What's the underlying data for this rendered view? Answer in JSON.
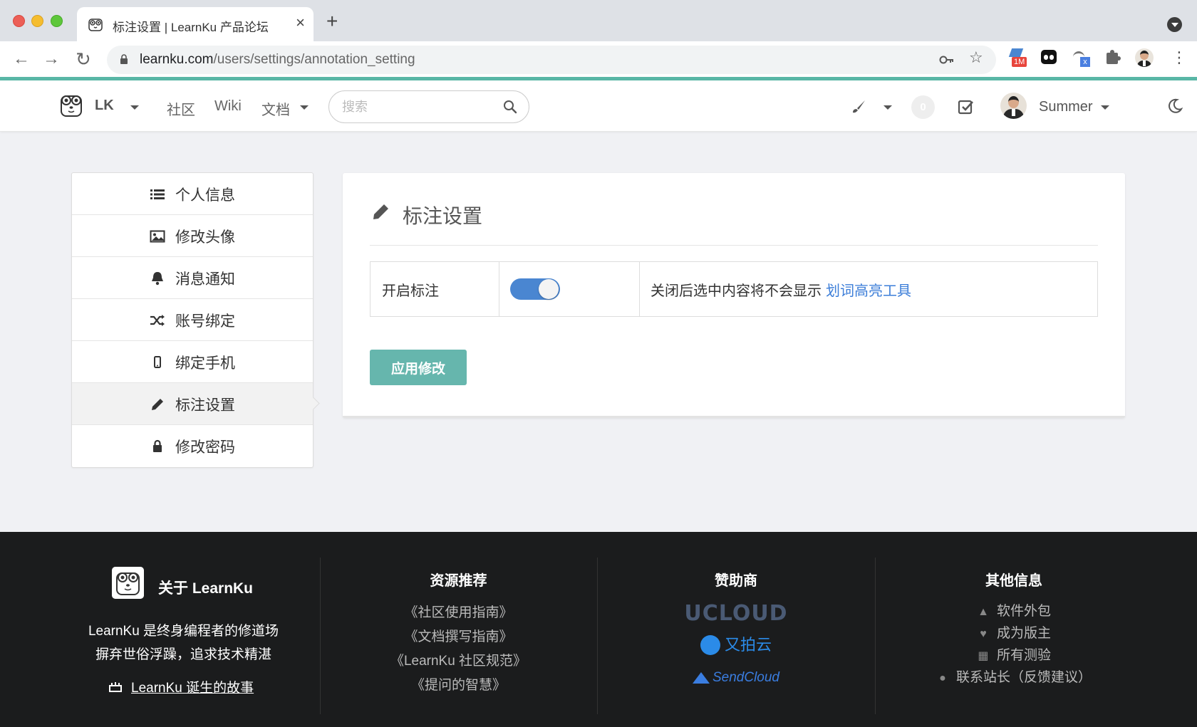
{
  "browser": {
    "tab_title": "标注设置 | LearnKu 产品论坛",
    "tab_close": "×",
    "new_tab": "+",
    "url_domain": "learnku.com",
    "url_path": "/users/settings/annotation_setting",
    "extension_badge": "1M"
  },
  "header": {
    "brand": "LK",
    "nav": [
      "社区",
      "Wiki",
      "文档"
    ],
    "search_placeholder": "搜索",
    "notification_count": "0",
    "user_name": "Summer"
  },
  "sidebar": {
    "items": [
      {
        "label": "个人信息",
        "icon": "list-icon"
      },
      {
        "label": "修改头像",
        "icon": "image-icon"
      },
      {
        "label": "消息通知",
        "icon": "bell-icon"
      },
      {
        "label": "账号绑定",
        "icon": "shuffle-icon"
      },
      {
        "label": "绑定手机",
        "icon": "mobile-icon"
      },
      {
        "label": "标注设置",
        "icon": "pencil-icon",
        "active": true
      },
      {
        "label": "修改密码",
        "icon": "lock-icon"
      }
    ]
  },
  "main": {
    "title": "标注设置",
    "setting": {
      "label": "开启标注",
      "enabled": true,
      "description": "关闭后选中内容将不会显示",
      "link_text": "划词高亮工具"
    },
    "apply_button": "应用修改"
  },
  "footer": {
    "about": {
      "title": "关于 LearnKu",
      "line1": "LearnKu 是终身编程者的修道场",
      "line2": "摒弃世俗浮躁，追求技术精湛",
      "story": "LearnKu 诞生的故事"
    },
    "resources": {
      "title": "资源推荐",
      "links": [
        "《社区使用指南》",
        "《文档撰写指南》",
        "《LearnKu 社区规范》",
        "《提问的智慧》"
      ]
    },
    "sponsors": {
      "title": "赞助商",
      "names": [
        "UCLOUD",
        "又拍云",
        "SendCloud"
      ]
    },
    "other": {
      "title": "其他信息",
      "links": [
        "软件外包",
        "成为版主",
        "所有测验",
        "联系站长（反馈建议）"
      ]
    }
  },
  "colors": {
    "accent": "#59b7a6",
    "button": "#66b6ad",
    "toggle": "#4a86d1",
    "link": "#3b7dd8",
    "footer_bg": "#1b1c1d"
  }
}
